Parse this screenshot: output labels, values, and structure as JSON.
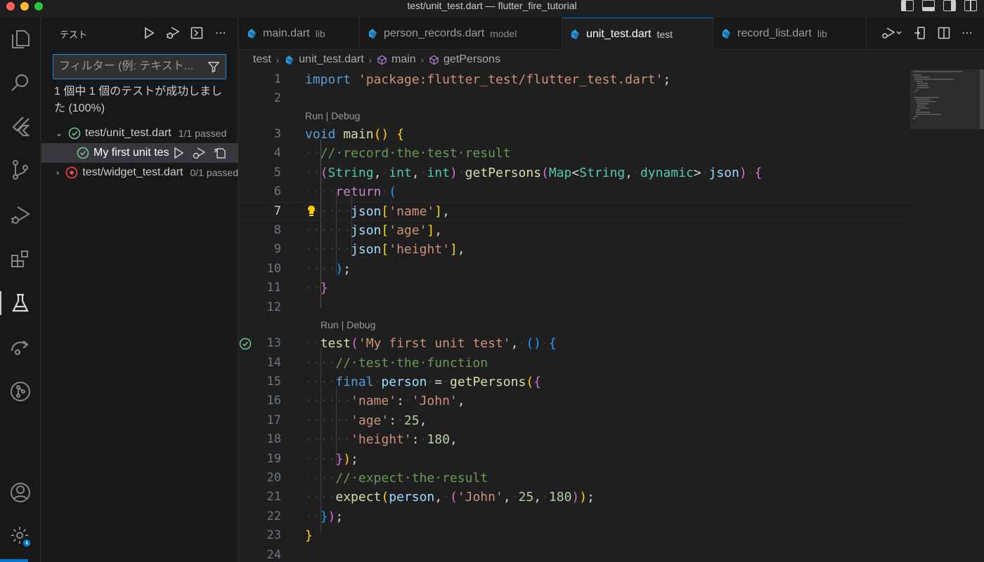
{
  "window": {
    "title": "test/unit_test.dart — flutter_fire_tutorial"
  },
  "sidebar": {
    "title": "テスト",
    "filter_placeholder": "フィルター (例: テキスト...",
    "summary": "1 個中 1 個のテストが成功しました (100%)",
    "tree": [
      {
        "label": "test/unit_test.dart",
        "desc": "1/1 passed",
        "status": "passed"
      },
      {
        "label": "My first unit test",
        "desc": "",
        "status": "passed"
      },
      {
        "label": "test/widget_test.dart",
        "desc": "0/1 passed",
        "status": "failed"
      }
    ]
  },
  "tabs": [
    {
      "label": "main.dart",
      "desc": "lib"
    },
    {
      "label": "person_records.dart",
      "desc": "model"
    },
    {
      "label": "unit_test.dart",
      "desc": "test"
    },
    {
      "label": "record_list.dart",
      "desc": "lib"
    }
  ],
  "breadcrumb": {
    "folder": "test",
    "file": "unit_test.dart",
    "symbol1": "main",
    "symbol2": "getPersons"
  },
  "codelens": {
    "main": "Run | Debug",
    "test": "Run | Debug"
  },
  "editor": {
    "current_line": "7",
    "lines": [
      {
        "n": "1",
        "text": "import 'package:flutter_test/flutter_test.dart';"
      },
      {
        "n": "2",
        "text": ""
      },
      {
        "n": "3",
        "text": "void main() {"
      },
      {
        "n": "4",
        "text": "  // record the test result"
      },
      {
        "n": "5",
        "text": "  (String, int, int) getPersons(Map<String, dynamic> json) {"
      },
      {
        "n": "6",
        "text": "    return ("
      },
      {
        "n": "7",
        "text": "      json['name'],"
      },
      {
        "n": "8",
        "text": "      json['age'],"
      },
      {
        "n": "9",
        "text": "      json['height'],"
      },
      {
        "n": "10",
        "text": "    );"
      },
      {
        "n": "11",
        "text": "  }"
      },
      {
        "n": "12",
        "text": ""
      },
      {
        "n": "13",
        "text": "  test('My first unit test', () {"
      },
      {
        "n": "14",
        "text": "    // test the function"
      },
      {
        "n": "15",
        "text": "    final person = getPersons({"
      },
      {
        "n": "16",
        "text": "      'name': 'John',"
      },
      {
        "n": "17",
        "text": "      'age': 25,"
      },
      {
        "n": "18",
        "text": "      'height': 180,"
      },
      {
        "n": "19",
        "text": "    });"
      },
      {
        "n": "20",
        "text": "    // expect the result"
      },
      {
        "n": "21",
        "text": "    expect(person, ('John', 25, 180));"
      },
      {
        "n": "22",
        "text": "  });"
      },
      {
        "n": "23",
        "text": "}"
      },
      {
        "n": "24",
        "text": ""
      }
    ]
  },
  "colors": {
    "accent": "#0078d4",
    "passed": "#73c991",
    "failed": "#f14c4c"
  }
}
